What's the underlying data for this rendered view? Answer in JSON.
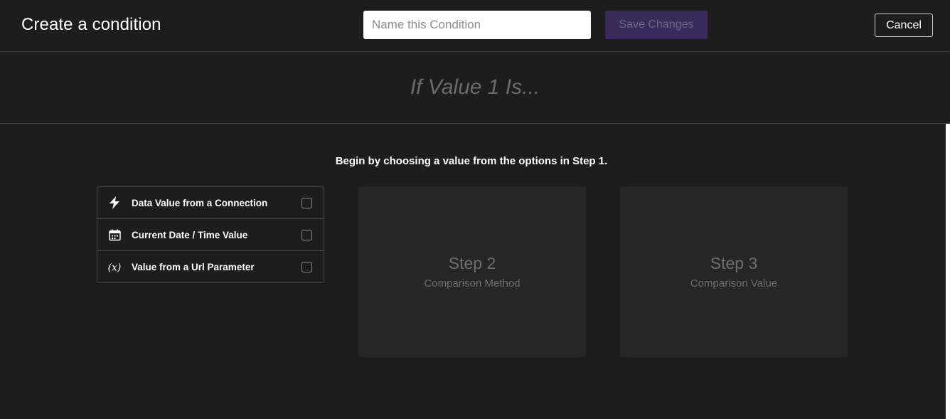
{
  "header": {
    "title": "Create a condition",
    "name_placeholder": "Name this Condition",
    "save_label": "Save Changes",
    "cancel_label": "Cancel"
  },
  "banner": {
    "text": "If Value 1 Is..."
  },
  "main": {
    "instruction": "Begin by choosing a value from the options in Step 1.",
    "options": [
      {
        "label": "Data Value from a Connection",
        "icon": "lightning-icon",
        "checked": false
      },
      {
        "label": "Current Date / Time Value",
        "icon": "calendar-icon",
        "checked": false
      },
      {
        "label": "Value from a Url Parameter",
        "icon": "variable-icon",
        "checked": false
      }
    ],
    "steps": [
      {
        "title": "Step 2",
        "subtitle": "Comparison Method"
      },
      {
        "title": "Step 3",
        "subtitle": "Comparison Value"
      }
    ]
  },
  "colors": {
    "background": "#1d1d1d",
    "save_button_bg": "#3a2a5c",
    "card_bg": "#262626"
  }
}
